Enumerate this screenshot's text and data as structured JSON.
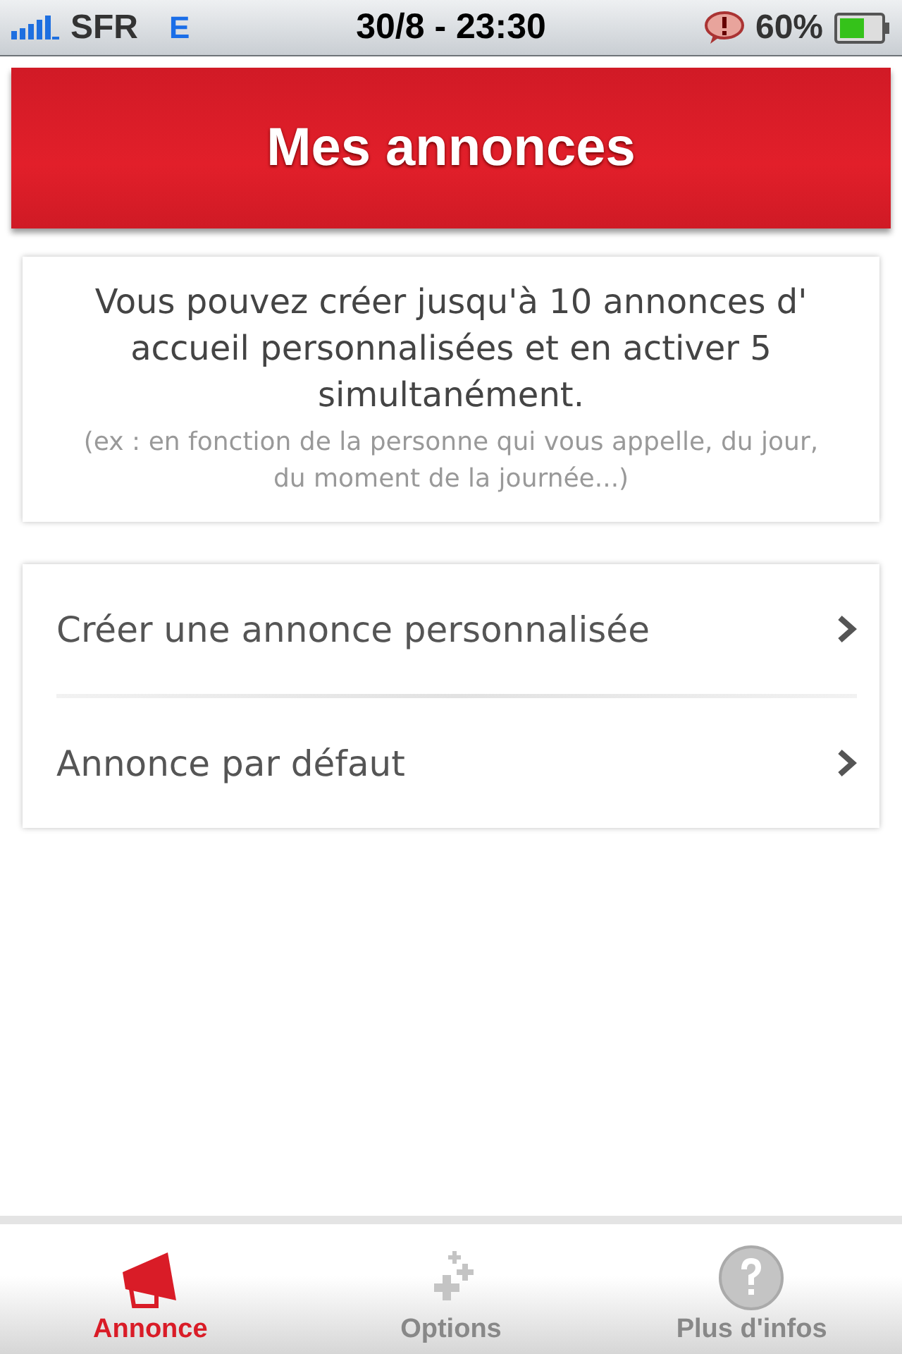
{
  "status_bar": {
    "carrier": "SFR",
    "network": "E",
    "time": "30/8 - 23:30",
    "battery": "60%"
  },
  "header": {
    "title": "Mes annonces"
  },
  "info": {
    "text": "Vous pouvez créer jusqu'à 10 annonces d' accueil personnalisées et en activer 5 simultanément.",
    "note": "(ex : en fonction de la personne qui vous appelle, du jour, du moment de la journée...)"
  },
  "menu": [
    {
      "label": "Créer une annonce personnalisée"
    },
    {
      "label": "Annonce par défaut"
    }
  ],
  "tab_bar": [
    {
      "label": "Annonce",
      "kind": "megaphone",
      "selected": true
    },
    {
      "label": "Options",
      "kind": "plus",
      "selected": false
    },
    {
      "label": "Plus d'infos",
      "kind": "help",
      "selected": false
    }
  ]
}
